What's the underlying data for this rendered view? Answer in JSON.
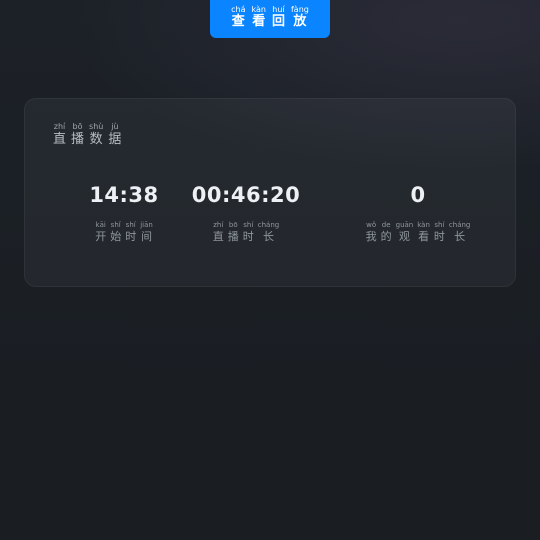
{
  "replay_button": {
    "chars": [
      {
        "py": "chá",
        "hz": "查"
      },
      {
        "py": "kàn",
        "hz": "看"
      },
      {
        "py": "huí",
        "hz": "回"
      },
      {
        "py": "fàng",
        "hz": "放"
      }
    ]
  },
  "card": {
    "title_chars": [
      {
        "py": "zhí",
        "hz": "直"
      },
      {
        "py": "bō",
        "hz": "播"
      },
      {
        "py": "shù",
        "hz": "数"
      },
      {
        "py": "jù",
        "hz": "据"
      }
    ],
    "stats": [
      {
        "value": "14:38",
        "label_chars": [
          {
            "py": "kāi",
            "hz": "开"
          },
          {
            "py": "shǐ",
            "hz": "始"
          },
          {
            "py": "shí",
            "hz": "时"
          },
          {
            "py": "jiān",
            "hz": "间"
          }
        ]
      },
      {
        "value": "00:46:20",
        "label_chars": [
          {
            "py": "zhí",
            "hz": "直"
          },
          {
            "py": "bō",
            "hz": "播"
          },
          {
            "py": "shí",
            "hz": "时"
          },
          {
            "py": "cháng",
            "hz": "长"
          }
        ]
      },
      {
        "value": "0",
        "label_chars": [
          {
            "py": "wǒ",
            "hz": "我"
          },
          {
            "py": "de",
            "hz": "的"
          },
          {
            "py": "guān",
            "hz": "观"
          },
          {
            "py": "kàn",
            "hz": "看"
          },
          {
            "py": "shí",
            "hz": "时"
          },
          {
            "py": "cháng",
            "hz": "长"
          }
        ]
      }
    ]
  },
  "colors": {
    "accent": "#0a84ff",
    "background": "#1b1f24"
  }
}
